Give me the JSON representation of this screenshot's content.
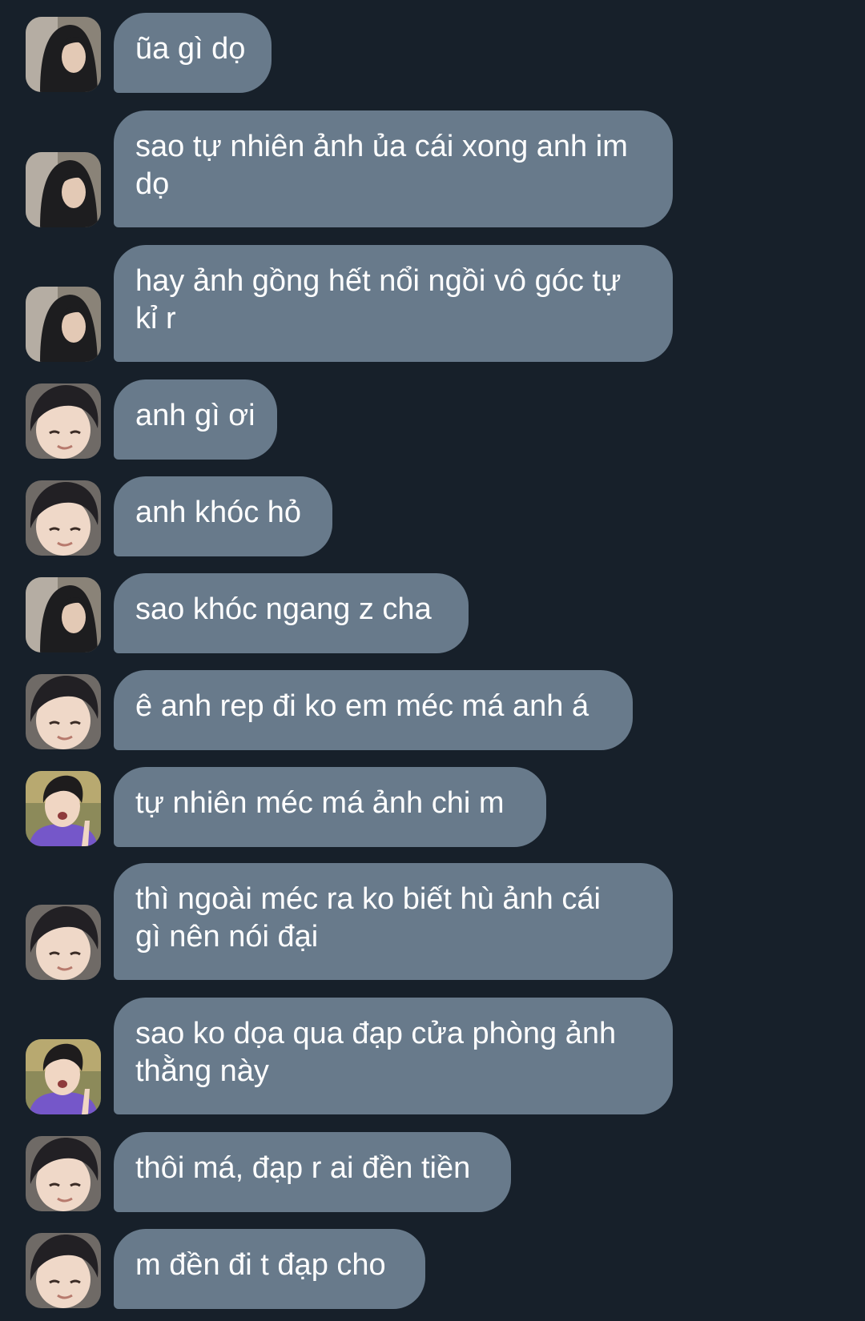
{
  "conversation": {
    "messages": [
      {
        "sender": "a",
        "text": "ũa gì dọ"
      },
      {
        "sender": "a",
        "text": "sao tự nhiên ảnh ủa cái xong anh im\ndọ"
      },
      {
        "sender": "a",
        "text": "hay ảnh gồng hết nổi ngồi vô góc tự\nkỉ r"
      },
      {
        "sender": "b",
        "text": "anh gì ơi"
      },
      {
        "sender": "b",
        "text": "anh khóc hỏ"
      },
      {
        "sender": "a",
        "text": "sao khóc ngang z cha"
      },
      {
        "sender": "b",
        "text": "ê anh rep đi ko em méc má anh á"
      },
      {
        "sender": "c",
        "text": "tự nhiên méc má ảnh chi m"
      },
      {
        "sender": "b",
        "text": "thì ngoài méc ra ko biết hù ảnh cái\ngì nên nói đại"
      },
      {
        "sender": "c",
        "text": "sao ko dọa qua đạp cửa phòng ảnh\nthằng này"
      },
      {
        "sender": "b",
        "text": "thôi má, đạp r ai đền tiền"
      },
      {
        "sender": "b",
        "text": "m đền đi t đạp cho"
      }
    ]
  },
  "colors": {
    "background": "#17202a",
    "bubble": "#687a8b",
    "text": "#ffffff"
  }
}
